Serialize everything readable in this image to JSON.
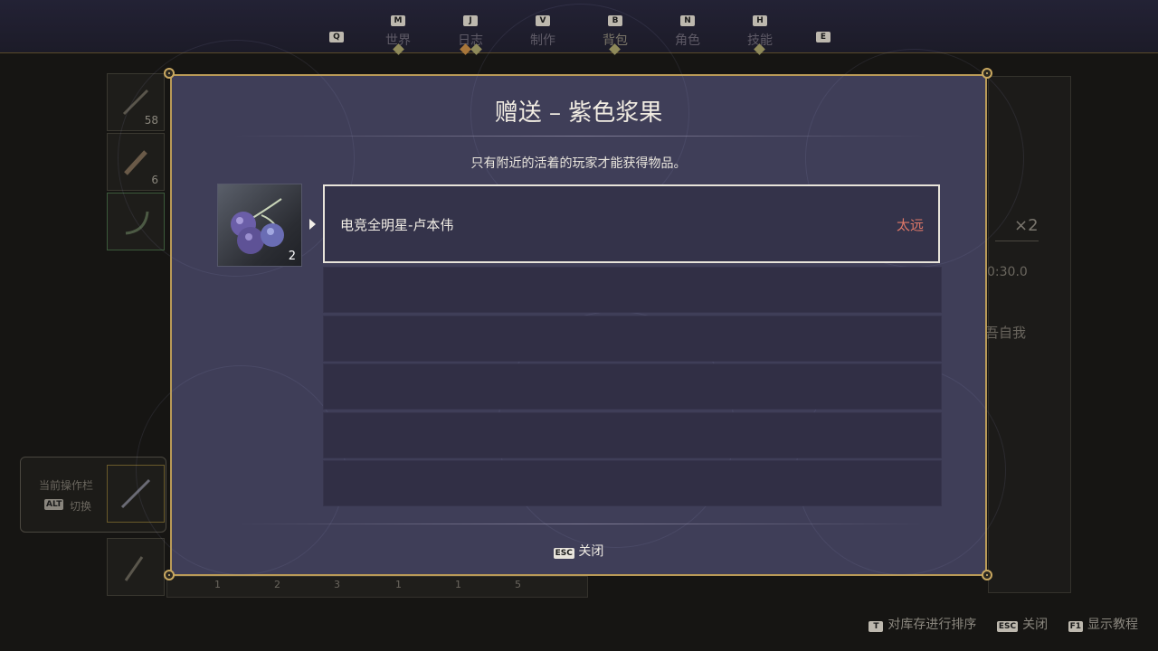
{
  "nav": {
    "left_key": "Q",
    "right_key": "E",
    "tabs": [
      {
        "key": "M",
        "label": "世界"
      },
      {
        "key": "J",
        "label": "日志"
      },
      {
        "key": "V",
        "label": "制作"
      },
      {
        "key": "B",
        "label": "背包"
      },
      {
        "key": "N",
        "label": "角色"
      },
      {
        "key": "H",
        "label": "技能"
      }
    ],
    "active_tab": "背包"
  },
  "background": {
    "slot_counts": [
      "58",
      "6"
    ],
    "hotbar_title": "当前操作栏",
    "hotbar_key": "ALT",
    "hotbar_action": "切换",
    "bottom_counts": [
      "1",
      "2",
      "3",
      "1",
      "1",
      "5"
    ],
    "right_multiplier": "×2",
    "right_timer": "0:30.0",
    "right_text": "吾自我"
  },
  "modal": {
    "title": "赠送 – 紫色浆果",
    "subtitle": "只有附近的活着的玩家才能获得物品。",
    "item": {
      "name_icon": "purple-berries-icon",
      "count": "2"
    },
    "players": [
      {
        "name": "电竞全明星-卢本伟",
        "status": "太远"
      }
    ],
    "empty_rows": 5,
    "close_key": "ESC",
    "close_label": "关闭"
  },
  "footer": {
    "sort_key": "T",
    "sort_label": "对库存进行排序",
    "close_key": "ESC",
    "close_label": "关闭",
    "tutorial_key": "F1",
    "tutorial_label": "显示教程"
  },
  "colors": {
    "modal_bg": "#3f3e58",
    "frame_gold": "#b99a57",
    "status_red": "#e07868"
  }
}
